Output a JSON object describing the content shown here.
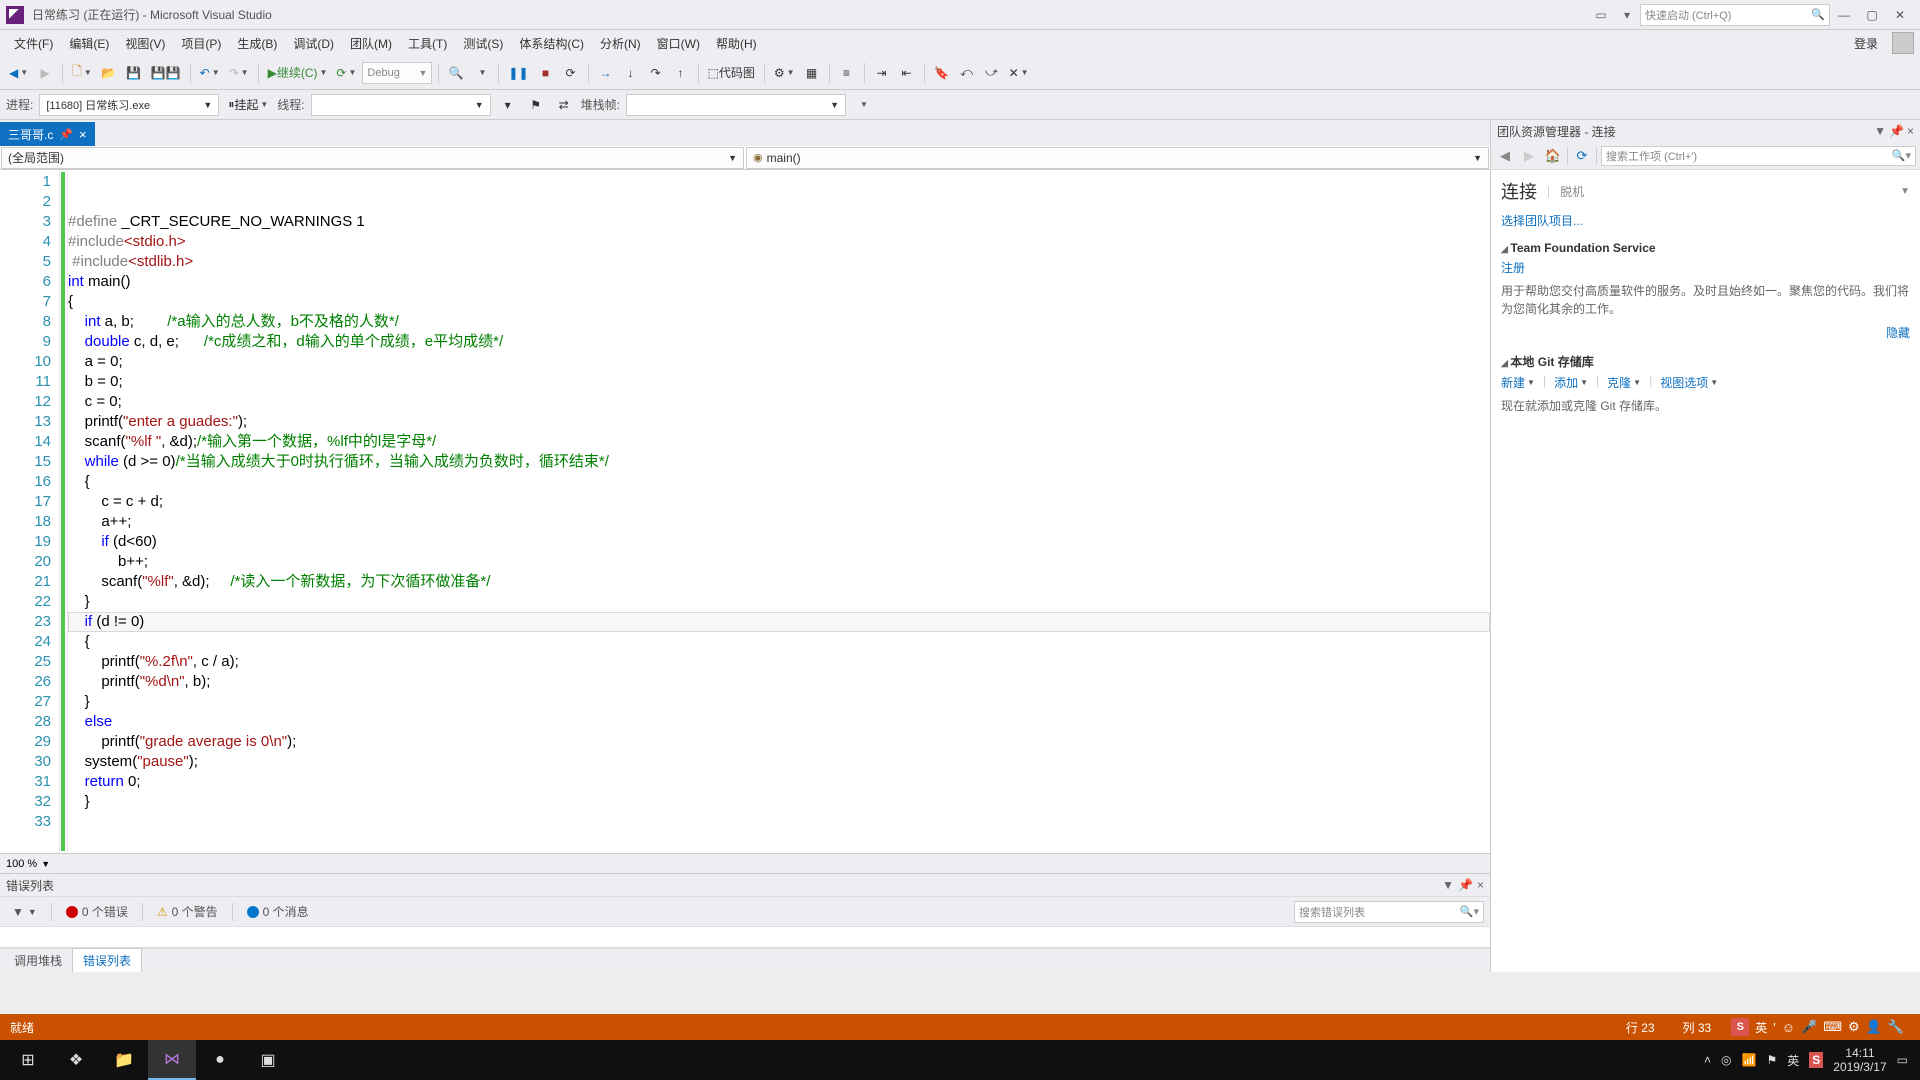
{
  "title": "日常练习 (正在运行) - Microsoft Visual Studio",
  "quick_launch_placeholder": "快速启动 (Ctrl+Q)",
  "menu": [
    "文件(F)",
    "编辑(E)",
    "视图(V)",
    "项目(P)",
    "生成(B)",
    "调试(D)",
    "团队(M)",
    "工具(T)",
    "测试(S)",
    "体系结构(C)",
    "分析(N)",
    "窗口(W)",
    "帮助(H)"
  ],
  "login": "登录",
  "toolbar": {
    "continue": "继续(C)",
    "debug_combo": "Debug",
    "codemap": "代码图"
  },
  "toolbar2": {
    "process_label": "进程:",
    "process_value": "[11680] 日常练习.exe",
    "suspend": "挂起",
    "thread_label": "线程:",
    "stackframe_label": "堆栈帧:"
  },
  "file_tab": "三哥哥.c",
  "nav_scope": "(全局范围)",
  "nav_member": "main()",
  "zoom": "100 %",
  "code": {
    "lines_count": 33,
    "l1": {
      "pp": "#define",
      "rest": " _CRT_SECURE_NO_WARNINGS 1"
    },
    "l2": {
      "pp": "#include",
      "inc": "<stdio.h>"
    },
    "l3": {
      "pp": "#include",
      "inc": "<stdlib.h>"
    },
    "l4": {
      "kw1": "int",
      "fn": " main()"
    },
    "l5": "{",
    "l6": {
      "indent": "    ",
      "kw": "int",
      "rest": " a, b;        ",
      "cm": "/*a输入的总人数，b不及格的人数*/"
    },
    "l7": {
      "indent": "    ",
      "kw": "double",
      "rest": " c, d, e;      ",
      "cm": "/*c成绩之和，d输入的单个成绩，e平均成绩*/"
    },
    "l8": "    a = 0;",
    "l9": "    b = 0;",
    "l10": "    c = 0;",
    "l11": {
      "indent": "    ",
      "fn": "printf",
      "open": "(",
      "str": "\"enter a guades:\"",
      "close": ");"
    },
    "l12": {
      "indent": "    ",
      "fn": "scanf",
      "open": "(",
      "str": "\"%lf \"",
      "rest": ", &d);",
      "cm": "/*输入第一个数据，%lf中的l是字母*/"
    },
    "l13": {
      "indent": "    ",
      "kw": "while",
      "rest": " (d >= 0)",
      "cm": "/*当输入成绩大于0时执行循环，当输入成绩为负数时，循环结束*/"
    },
    "l14": "    {",
    "l15": "        c = c + d;",
    "l16": "        a++;",
    "l17": {
      "indent": "        ",
      "kw": "if",
      "rest": " (d<60)"
    },
    "l18": "            b++;",
    "l19": {
      "indent": "        ",
      "fn": "scanf",
      "open": "(",
      "str": "\"%lf\"",
      "rest": ", &d);     ",
      "cm": "/*读入一个新数据，为下次循环做准备*/"
    },
    "l20": "    }",
    "l21": {
      "indent": "    ",
      "kw": "if",
      "rest": " (d != 0)"
    },
    "l22": "    {",
    "l23": {
      "indent": "        ",
      "fn": "printf",
      "open": "(",
      "str": "\"%.2f\\n\"",
      "rest": ", c / a);"
    },
    "l24": {
      "indent": "        ",
      "fn": "printf",
      "open": "(",
      "str": "\"%d\\n\"",
      "rest": ", b);"
    },
    "l25": "    }",
    "l26": {
      "indent": "    ",
      "kw": "else"
    },
    "l27": {
      "indent": "        ",
      "fn": "printf",
      "open": "(",
      "str": "\"grade average is 0\\n\"",
      "close": ");"
    },
    "l28": {
      "indent": "    ",
      "fn": "system",
      "open": "(",
      "str": "\"pause\"",
      "close": ");"
    },
    "l29": {
      "indent": "    ",
      "kw": "return",
      "rest": " 0;"
    },
    "l30": "    }",
    "l31": "",
    "l32": "",
    "l33": ""
  },
  "error_panel": {
    "title": "错误列表",
    "errors": "0 个错误",
    "warnings": "0 个警告",
    "messages": "0 个消息",
    "search_placeholder": "搜索错误列表",
    "tabs": [
      "调用堆栈",
      "错误列表"
    ]
  },
  "team_explorer": {
    "title": "团队资源管理器 - 连接",
    "search_placeholder": "搜索工作项 (Ctrl+')",
    "connect": "连接",
    "offline": "脱机",
    "select_projects": "选择团队项目...",
    "tfs_head": "Team Foundation Service",
    "register": "注册",
    "tfs_desc": "用于帮助您交付高质量软件的服务。及时且始终如一。聚焦您的代码。我们将为您简化其余的工作。",
    "hide": "隐藏",
    "git_head": "本地 Git 存储库",
    "git_actions": [
      "新建",
      "添加",
      "克隆",
      "视图选项"
    ],
    "git_desc": "现在就添加或克隆 Git 存储库。"
  },
  "status": {
    "ready": "就绪",
    "line": "行 23",
    "col": "列 33",
    "ime_lang": "英"
  },
  "taskbar": {
    "time": "14:11",
    "date": "2019/3/17",
    "ime_tray": "英"
  }
}
